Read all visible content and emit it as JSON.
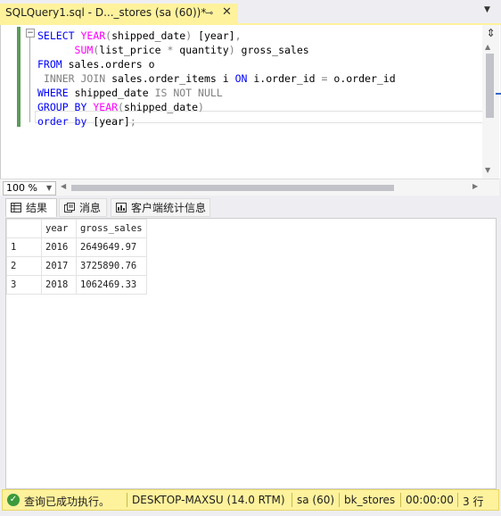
{
  "tab": {
    "title": "SQLQuery1.sql - D..._stores (sa (60))*",
    "pin_glyph": "⊸",
    "close_glyph": "✕",
    "dropdown_glyph": "▼"
  },
  "editor": {
    "lines": [
      {
        "parts": [
          [
            "kw",
            "SELECT "
          ],
          [
            "fn",
            "YEAR"
          ],
          [
            "gr",
            "("
          ],
          [
            "",
            "shipped_date"
          ],
          [
            "gr",
            ")"
          ],
          [
            "",
            " [year]"
          ],
          [
            "gr",
            ","
          ]
        ]
      },
      {
        "parts": [
          [
            "",
            " "
          ],
          [
            "fn",
            "     SUM"
          ],
          [
            "gr",
            "("
          ],
          [
            "",
            "list_price "
          ],
          [
            "gr",
            "*"
          ],
          [
            "",
            " quantity"
          ],
          [
            "gr",
            ")"
          ],
          [
            "",
            " gross_sales"
          ]
        ]
      },
      {
        "parts": [
          [
            "kw",
            "FROM "
          ],
          [
            "",
            "sales.orders o"
          ]
        ]
      },
      {
        "parts": [
          [
            "",
            " "
          ],
          [
            "gr",
            "INNER JOIN "
          ],
          [
            "",
            "sales.order_items i "
          ],
          [
            "kw",
            "ON "
          ],
          [
            "",
            "i.order_id "
          ],
          [
            "gr",
            "="
          ],
          [
            "",
            " o.order_id"
          ]
        ]
      },
      {
        "parts": [
          [
            "kw",
            "WHERE "
          ],
          [
            "",
            "shipped_date "
          ],
          [
            "gr",
            "IS NOT NULL"
          ]
        ]
      },
      {
        "parts": [
          [
            "kw",
            "GROUP BY "
          ],
          [
            "fn",
            "YEAR"
          ],
          [
            "gr",
            "("
          ],
          [
            "",
            "shipped_date"
          ],
          [
            "gr",
            ")"
          ]
        ]
      },
      {
        "parts": [
          [
            "kw",
            "order by "
          ],
          [
            "",
            "[year]"
          ],
          [
            "gr",
            ";"
          ]
        ]
      }
    ]
  },
  "zoom": {
    "value": "100 %"
  },
  "results_tabs": {
    "results": "结果",
    "messages": "消息",
    "client_stats": "客户端统计信息"
  },
  "grid": {
    "columns": [
      "",
      "year",
      "gross_sales"
    ],
    "rows": [
      {
        "num": "1",
        "year": "2016",
        "gross_sales": "2649649.97"
      },
      {
        "num": "2",
        "year": "2017",
        "gross_sales": "3725890.76"
      },
      {
        "num": "3",
        "year": "2018",
        "gross_sales": "1062469.33"
      }
    ]
  },
  "status": {
    "message": "查询已成功执行。",
    "server": "DESKTOP-MAXSU (14.0 RTM)",
    "user": "sa (60)",
    "database": "bk_stores",
    "elapsed": "00:00:00",
    "rows": "3 行"
  },
  "colors": {
    "tab_accent": "#FFF29D",
    "keyword": "#0000FF",
    "function": "#FF00FF",
    "operator": "#808080",
    "success": "#3C9A3C"
  }
}
